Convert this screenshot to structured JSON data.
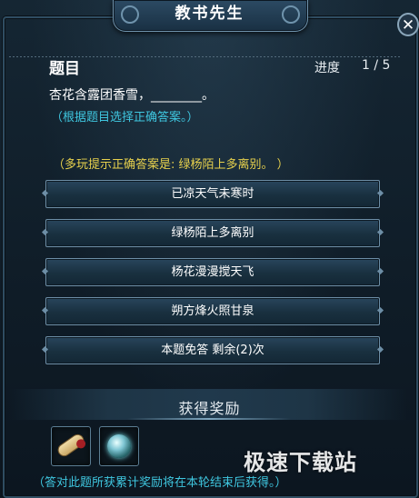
{
  "window": {
    "title": "教书先生",
    "close_glyph": "✕"
  },
  "question": {
    "heading": "题目",
    "progress_label": "进度",
    "progress_value": "1 / 5",
    "text": "杏花含露团香雪，________。",
    "hint": "（根据题目选择正确答案。）",
    "multiplayer_prompt": "（多玩提示正确答案是: 绿杨陌上多离别。 ）"
  },
  "answers": [
    {
      "label": "已凉天气未寒时"
    },
    {
      "label": "绿杨陌上多离别"
    },
    {
      "label": "杨花漫漫搅天飞"
    },
    {
      "label": "朔方烽火照甘泉"
    },
    {
      "label": "本题免答 剩余(2)次"
    }
  ],
  "reward": {
    "title": "获得奖励",
    "items": [
      {
        "icon": "scroll-icon"
      },
      {
        "icon": "jade-orb-icon"
      }
    ],
    "footer_note": "（答对此题所获累计奖励将在本轮结束后获得。）"
  },
  "watermark": {
    "text": "极速下载站"
  },
  "colors": {
    "accent_cyan": "#3fc7e0",
    "prompt_yellow": "#e7d14d",
    "button_border": "#6d8ea6"
  }
}
